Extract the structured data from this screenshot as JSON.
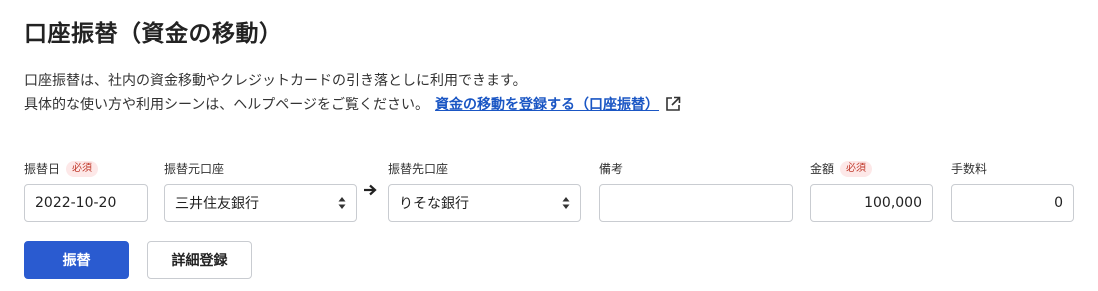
{
  "page": {
    "title": "口座振替（資金の移動）",
    "desc_line1": "口座振替は、社内の資金移動やクレジットカードの引き落としに利用できます。",
    "desc_line2": "具体的な使い方や利用シーンは、ヘルプページをご覧ください。",
    "help_link": "資金の移動を登録する（口座振替）",
    "help_link_icon": "external-link-icon"
  },
  "form": {
    "required_badge": "必須",
    "date": {
      "label": "振替日",
      "value": "2022-10-20",
      "required": true
    },
    "from_account": {
      "label": "振替元口座",
      "value": "三井住友銀行"
    },
    "to_account": {
      "label": "振替先口座",
      "value": "りそな銀行"
    },
    "memo": {
      "label": "備考",
      "value": ""
    },
    "amount": {
      "label": "金額",
      "value": "100,000",
      "required": true
    },
    "fee": {
      "label": "手数料",
      "value": "0"
    },
    "arrow_icon": "arrow-right-icon"
  },
  "actions": {
    "submit_label": "振替",
    "detail_label": "詳細登録"
  },
  "colors": {
    "primary": "#2a5bd0",
    "link": "#1a56c4",
    "required_text": "#c0392b",
    "required_bg": "#fde8e8"
  }
}
